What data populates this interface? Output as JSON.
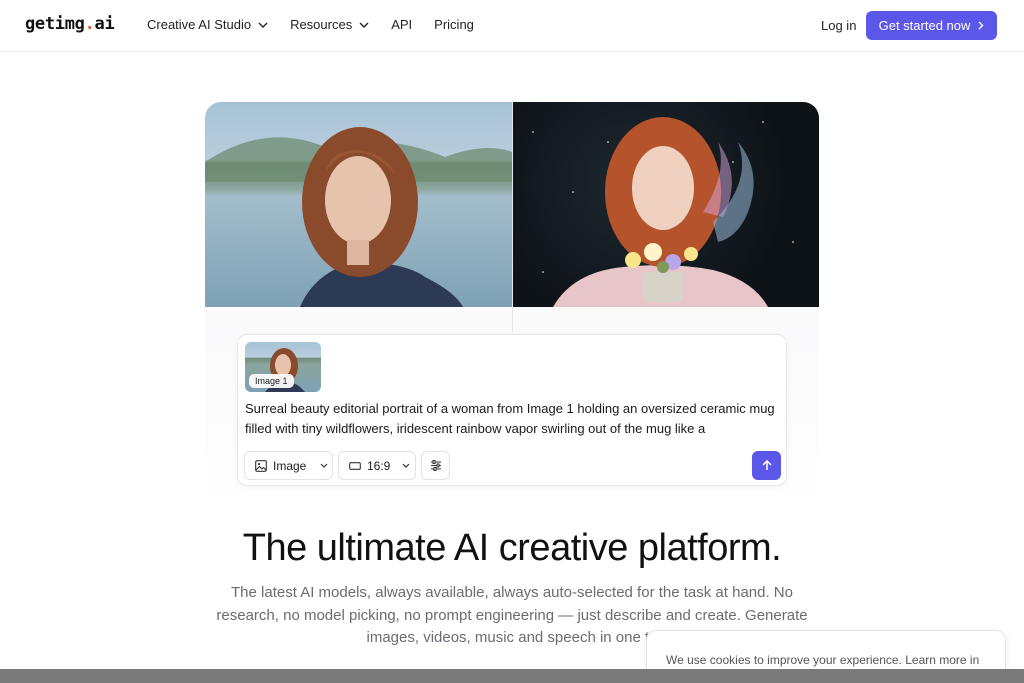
{
  "header": {
    "logo_main": "getimg",
    "logo_dot": ".",
    "logo_tld": "ai",
    "menu": [
      {
        "label": "Creative AI Studio",
        "has_dropdown": true
      },
      {
        "label": "Resources",
        "has_dropdown": true
      },
      {
        "label": "API",
        "has_dropdown": false
      },
      {
        "label": "Pricing",
        "has_dropdown": false
      }
    ],
    "login_label": "Log in",
    "cta_label": "Get started now"
  },
  "prompt": {
    "reference_label": "Image 1",
    "text": "Surreal beauty editorial portrait of a woman from Image 1 holding an oversized ceramic mug filled with tiny wildflowers, iridescent rainbow vapor swirling out of the mug like a",
    "type_selector": "Image",
    "ratio_selector": "16:9"
  },
  "hero": {
    "headline": "The ultimate AI creative platform.",
    "subtitle": "The latest AI models, always available, always auto-selected for the task at hand. No research, no model picking, no prompt engineering — just describe and create. Generate images, videos, music and speech in one to"
  },
  "cookie": {
    "text": "We use cookies to improve your experience. Learn more in"
  },
  "colors": {
    "accent": "#5b57e8",
    "logo_dot": "#e0623a",
    "text_muted": "#6b6b73"
  }
}
